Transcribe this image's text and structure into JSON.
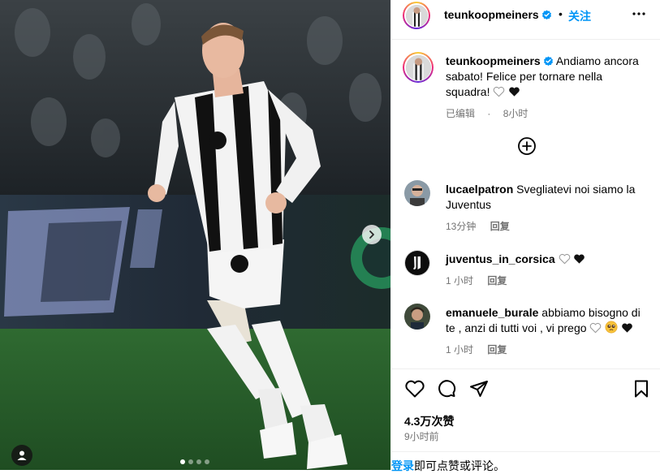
{
  "post": {
    "username": "teunkoopmeiners",
    "dot": "•",
    "follow_label": "关注",
    "more_label": "•••"
  },
  "caption": {
    "username": "teunkoopmeiners",
    "text": "Andiamo ancora sabato! Felice per tornare nella squadra!",
    "edited": "已编辑",
    "separator": "·",
    "time": "8小时"
  },
  "comments": [
    {
      "username": "lucaelpatron",
      "text": "Svegliatevi noi siamo la Juventus",
      "time": "13分钟",
      "reply": "回复"
    },
    {
      "username": "juventus_in_corsica",
      "text": "",
      "time": "1 小时",
      "reply": "回复"
    },
    {
      "username": "emanuele_burale",
      "text": "abbiamo bisogno di te , anzi di tutti voi , vi prego",
      "time": "1 小时",
      "reply": "回复"
    }
  ],
  "footer": {
    "likes": "4.3万次赞",
    "time": "9小时前",
    "login_link": "登录",
    "login_text": "即可点赞或评论。"
  },
  "carousel": {
    "total": 4,
    "active": 0
  },
  "colors": {
    "accent": "#0095f6",
    "verified": "#0095f6",
    "meta_gray": "#737373"
  }
}
